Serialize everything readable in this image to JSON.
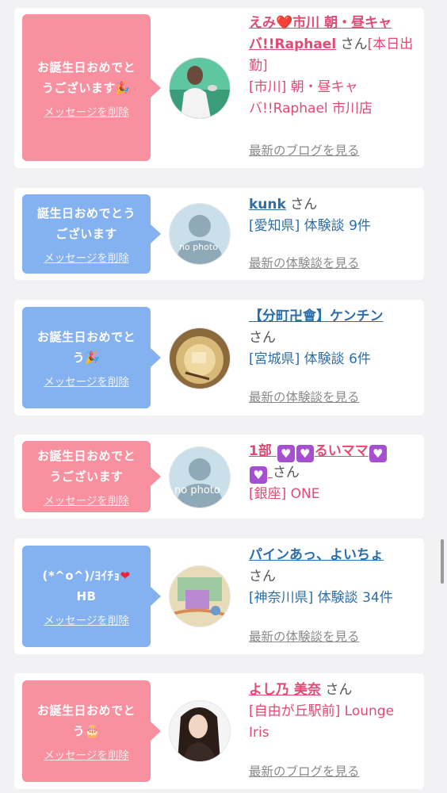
{
  "cards": [
    {
      "bubble_msg": "お誕生日おめでとうございます🎉",
      "delete_label": "メッセージを削除",
      "name": "えみ❤️市川 朝・昼キャバ!!Raphael",
      "san": "さん",
      "tag": "[本日出勤]",
      "shop": "[市川] 朝・昼キャバ!!Raphael 市川店",
      "more_link": "最新のブログを見る"
    },
    {
      "bubble_msg": "誕生日おめでとうございます",
      "delete_label": "メッセージを削除",
      "name": "kunk",
      "san": "さん",
      "shop": "[愛知県] 体験談 9件",
      "more_link": "最新の体験談を見る",
      "avatar_text": "no photo"
    },
    {
      "bubble_msg": "お誕生日おめでとう🎉",
      "delete_label": "メッセージを削除",
      "name": "【分町卍會】ケンチン",
      "san": "さん",
      "shop": "[宮城県] 体験談 6件",
      "more_link": "最新の体験談を見る"
    },
    {
      "bubble_msg": "お誕生日おめでとうございます",
      "delete_label": "メッセージを削除",
      "name": "1部 💟💟るいママ💟💟",
      "name_main": "1部",
      "name_mid": "るいママ",
      "san": "さん",
      "shop": "[銀座] ONE",
      "avatar_text": "no photo"
    },
    {
      "bubble_msg": "(*^o^)/ﾖｲﾁｮ❤️HB",
      "bubble_line1": "(*^o^)/ﾖｲﾁｮ",
      "bubble_line2": "HB",
      "delete_label": "メッセージを削除",
      "name": "パインあっ、よいちょ",
      "san": "さん",
      "shop": "[神奈川県] 体験談 34件",
      "more_link": "最新の体験談を見る"
    },
    {
      "bubble_msg": "お誕生日おめでとう🎂",
      "delete_label": "メッセージを削除",
      "name": "よし乃 美奈",
      "san": "さん",
      "shop": "[自由が丘駅前] Lounge Iris",
      "more_link": "最新のブログを見る"
    }
  ]
}
